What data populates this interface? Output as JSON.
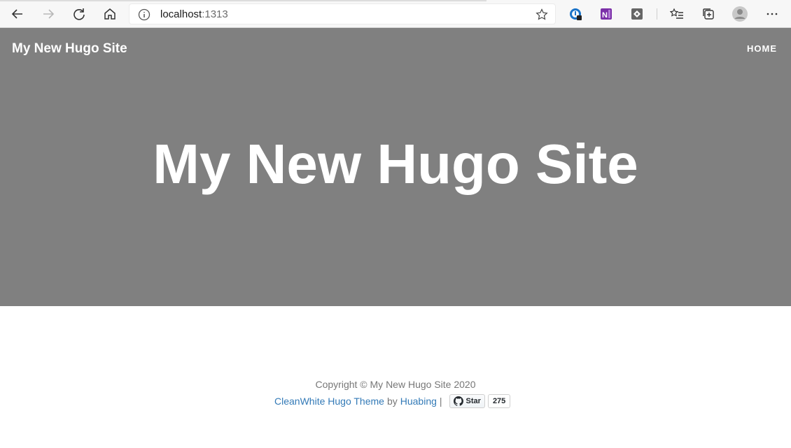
{
  "browser": {
    "url_host": "localhost",
    "url_port": ":1313"
  },
  "site": {
    "brand": "My New Hugo Site",
    "nav_home": "HOME",
    "hero_title": "My New Hugo Site"
  },
  "footer": {
    "copyright": "Copyright © My New Hugo Site 2020",
    "theme_link": "CleanWhite Hugo Theme",
    "by_text": "by",
    "author_link": "Huabing",
    "separator": "|",
    "star_label": "Star",
    "star_count": "275"
  },
  "colors": {
    "hero_bg": "#808080",
    "link": "#337ab7",
    "footer_text": "#777777"
  }
}
